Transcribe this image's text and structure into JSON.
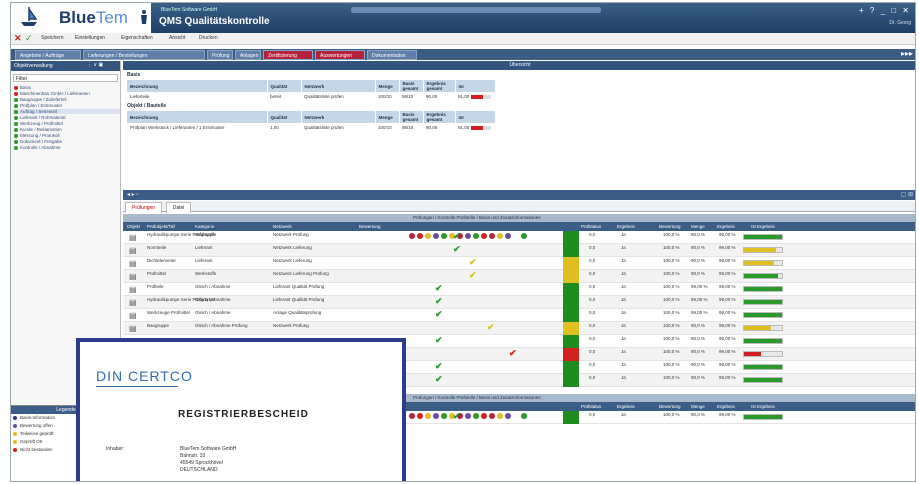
{
  "app": {
    "brand_bold": "Blue",
    "brand_light": "Tem",
    "company": "BlueTem Software GmbH",
    "title": "QMS Qualitätskontrolle",
    "window_controls": "+ ? _ □ ✕",
    "user": "Dr. Georg"
  },
  "menu": {
    "items": [
      "Speichern",
      "Einstellungen",
      "Eigenschaften",
      "Ansicht",
      "Drucken"
    ]
  },
  "tabs": [
    {
      "label": "Angebote / Aufträge",
      "style": "normal"
    },
    {
      "label": "Lieferungen / Bestellungen",
      "style": "normal"
    },
    {
      "label": "Prüfung",
      "style": "normal"
    },
    {
      "label": "Anlagen",
      "style": "normal"
    },
    {
      "label": "Zertifizierung",
      "style": "red"
    },
    {
      "label": "Auswertungen",
      "style": "red"
    },
    {
      "label": "Dokumentation",
      "style": "normal"
    }
  ],
  "sidebar": {
    "title": "Objektverwaltung",
    "filter": "Filter",
    "items": [
      {
        "label": "Basis",
        "color": "#d02020",
        "selected": false
      },
      {
        "label": "Maschinenbau GmbH / Lieferanten",
        "color": "#d02020",
        "selected": false
      },
      {
        "label": "Baugruppe / Zulieferteil",
        "color": "#2a9a2a",
        "selected": false
      },
      {
        "label": "Prüfplan / Erstmuster",
        "color": "#2a9a2a",
        "selected": false
      },
      {
        "label": "Auftrag / Serienteil",
        "color": "#2a9a2a",
        "selected": true
      },
      {
        "label": "Lieferant / Rohmaterial",
        "color": "#2a9a2a",
        "selected": false
      },
      {
        "label": "Werkzeug / Prüfmittel",
        "color": "#2a9a2a",
        "selected": false
      },
      {
        "label": "Kunde / Reklamation",
        "color": "#2a9a2a",
        "selected": false
      },
      {
        "label": "Messung / Protokoll",
        "color": "#2a9a2a",
        "selected": false
      },
      {
        "label": "Dokument / Freigabe",
        "color": "#2a9a2a",
        "selected": false
      },
      {
        "label": "Kontrolle / Abnahme",
        "color": "#2a9a2a",
        "selected": false
      }
    ]
  },
  "legend": {
    "title": "Legende",
    "items": [
      {
        "label": "Basis-Information",
        "color": "#2c3c8c"
      },
      {
        "label": "Bewertung offen",
        "color": "#6a4ca0"
      },
      {
        "label": "Teilweise geprüft",
        "color": "#e0c020"
      },
      {
        "label": "Geprüft OK",
        "color": "#e0c020"
      },
      {
        "label": "Nicht bestanden",
        "color": "#d02020"
      }
    ]
  },
  "upper": {
    "header": "Übersicht",
    "section1": "Basis",
    "section2": "Objekt / Bauteile",
    "cols": [
      "Bezeichnung",
      "Qualität",
      "Netzwerk",
      "Menge",
      "Basis gesamt",
      "Ergebnis gesamt",
      "Ist",
      "Ergebnis"
    ],
    "row1": [
      "Lieferteile",
      "bereit",
      "Qualitätsliste prüfen",
      "100/10",
      "98/10",
      "90,00",
      "91,00"
    ],
    "row2": [
      "Prüfplan Werkstück / Lieferanten / 1 Erstmuster",
      "1,00",
      "Qualitätsliste prüfen",
      "100/10",
      "98/10",
      "90,00",
      "91,00"
    ],
    "bar1_level": 0.6,
    "bar2_level": 0.6
  },
  "lower": {
    "tabs": [
      "Prüfungen",
      "Datei"
    ],
    "group1": "Prüfungen / Kontrolle Prüfstelle / Basis und Zusatzinformationen",
    "group2": "Prüfungen / Kontrolle Prüfstelle / Basis und Zusatzinformationen",
    "cols": [
      "Objekt",
      "Prüfobjekt/Teil",
      "Kategorie",
      "Netzwerk",
      "Bewertung",
      "Prüfstatus",
      "Ergebnis",
      "Bewertung",
      "Menge",
      "Ergebnis",
      "Ist Ergebnis"
    ],
    "rows": [
      {
        "name": "Hydraulikpumpe Serie Prüfgruppe",
        "cat": "Werkstoffe",
        "net": "Netzwerk Prüfung",
        "check": "g",
        "check_col": 330,
        "status": "#1e8c1e",
        "a": "0,0",
        "b": "Ja",
        "c": "100,0 %",
        "d": "90,0 %",
        "e": "99,00 %",
        "level": 1.0,
        "bar": "#2a9a2a"
      },
      {
        "name": "Normteile",
        "cat": "Lieferant",
        "net": "Netzwerk Lieferung",
        "check": "g",
        "check_col": 330,
        "status": "#1e8c1e",
        "a": "0,0",
        "b": "Ja",
        "c": "100,0 %",
        "d": "90,0 %",
        "e": "99,00 %",
        "level": 0.85,
        "bar": "#e0c020"
      },
      {
        "name": "Dichtelemente",
        "cat": "Lieferant",
        "net": "Netzwerk Lieferung",
        "check": "y",
        "check_col": 346,
        "status": "#e0c020",
        "a": "0,0",
        "b": "Ja",
        "c": "100,0 %",
        "d": "90,0 %",
        "e": "99,00 %",
        "level": 0.8,
        "bar": "#e0c020"
      },
      {
        "name": "Prüfmittel",
        "cat": "Werkstoffe",
        "net": "Netzwerk Lieferung Prüfung",
        "check": "y",
        "check_col": 346,
        "status": "#e0c020",
        "a": "0,0",
        "b": "Ja",
        "c": "100,0 %",
        "d": "90,0 %",
        "e": "99,00 %",
        "level": 0.9,
        "bar": "#2a9a2a"
      },
      {
        "name": "Prüfteile",
        "cat": "Gleich / Abnahme",
        "net": "Lieferant Qualität Prüfung",
        "check": "g",
        "check_col": 312,
        "status": "#1e8c1e",
        "a": "0,0",
        "b": "Ja",
        "c": "100,0 %",
        "d": "99,00 %",
        "e": "99,00 %",
        "level": 1.0,
        "bar": "#2a9a2a"
      },
      {
        "name": "Hydraulikpumpe Serie Prüfgruppe",
        "cat": "Gleich / Abnahme",
        "net": "Lieferant Qualität Prüfung",
        "check": "g",
        "check_col": 312,
        "status": "#1e8c1e",
        "a": "0,0",
        "b": "Ja",
        "c": "100,0 %",
        "d": "99,00 %",
        "e": "99,00 %",
        "level": 1.0,
        "bar": "#2a9a2a"
      },
      {
        "name": "Werkzeuge Prüfmittel",
        "cat": "Gleich / Abnahme",
        "net": "Anlage Qualitätsprüfung",
        "check": "g",
        "check_col": 312,
        "status": "#1e8c1e",
        "a": "0,0",
        "b": "Ja",
        "c": "100,0 %",
        "d": "99,00 %",
        "e": "99,00 %",
        "level": 1.0,
        "bar": "#2a9a2a"
      },
      {
        "name": "Baugruppe",
        "cat": "Gleich / Abnahme Prüfung",
        "net": "Netzwerk Prüfung",
        "check": "y",
        "check_col": 364,
        "status": "#e0c020",
        "a": "0,0",
        "b": "Ja",
        "c": "100,0 %",
        "d": "90,0 %",
        "e": "99,00 %",
        "level": 0.7,
        "bar": "#e0c020"
      },
      {
        "name": "",
        "cat": "",
        "net": "",
        "check": "g",
        "check_col": 312,
        "status": "#1e8c1e",
        "a": "0,0",
        "b": "Ja",
        "c": "100,0 %",
        "d": "90,0 %",
        "e": "99,00 %",
        "level": 1.0,
        "bar": "#2a9a2a"
      },
      {
        "name": "",
        "cat": "",
        "net": "",
        "check": "r",
        "check_col": 386,
        "status": "#d02020",
        "a": "0,0",
        "b": "Ja",
        "c": "100,0 %",
        "d": "90,0 %",
        "e": "99,00 %",
        "level": 0.45,
        "bar": "#d02020"
      },
      {
        "name": "",
        "cat": "",
        "net": "",
        "check": "g",
        "check_col": 312,
        "status": "#1e8c1e",
        "a": "0,0",
        "b": "Ja",
        "c": "100,0 %",
        "d": "90,0 %",
        "e": "99,00 %",
        "level": 1.0,
        "bar": "#2a9a2a"
      },
      {
        "name": "",
        "cat": "",
        "net": "",
        "check": "g",
        "check_col": 312,
        "status": "#1e8c1e",
        "a": "0,0",
        "b": "Ja",
        "c": "100,0 %",
        "d": "90,0 %",
        "e": "99,00 %",
        "level": 1.0,
        "bar": "#2a9a2a"
      }
    ],
    "row2": {
      "check": "g",
      "status": "#1e8c1e",
      "a": "0,0",
      "b": "Ja",
      "c": "100,0 %",
      "d": "90,0 %",
      "e": "99,00 %",
      "level": 1.0,
      "bar": "#2a9a2a"
    }
  },
  "certificate": {
    "logo": "DIN CERTCO",
    "title": "REGISTRIERBESCHEID",
    "inhaber_label": "Inhaber:",
    "lines": [
      "BlueTem Software GmbH",
      "Bahnstr. 33",
      "45549 Sprockhövel",
      "DEUTSCHLAND"
    ]
  },
  "colors": {
    "status_green": "#1e8c1e",
    "status_yellow": "#e0c020",
    "status_red": "#d02020",
    "header_blue": "#33557d"
  }
}
